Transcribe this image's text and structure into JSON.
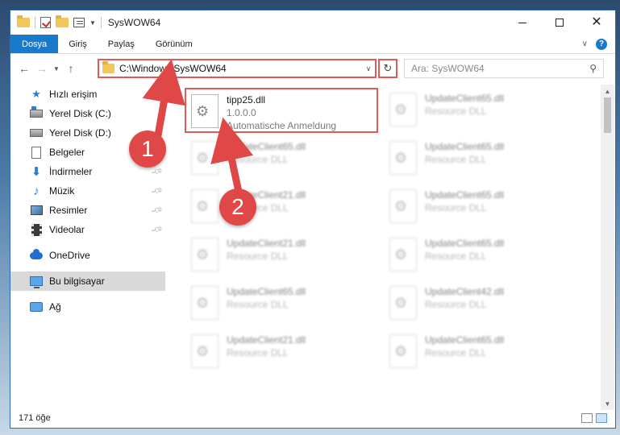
{
  "window": {
    "title": "SysWOW64"
  },
  "ribbon": {
    "tabs": [
      "Dosya",
      "Giriş",
      "Paylaş",
      "Görünüm"
    ]
  },
  "address": {
    "path": "C:\\Windows\\SysWOW64"
  },
  "search": {
    "placeholder": "Ara: SysWOW64"
  },
  "sidebar": {
    "items": [
      {
        "label": "Hızlı erişim",
        "icon": "star-icon"
      },
      {
        "label": "Yerel Disk (C:)",
        "icon": "drive-icon"
      },
      {
        "label": "Yerel Disk (D:)",
        "icon": "drive-icon"
      },
      {
        "label": "Belgeler",
        "icon": "document-icon"
      },
      {
        "label": "İndirmeler",
        "icon": "download-icon"
      },
      {
        "label": "Müzik",
        "icon": "music-icon"
      },
      {
        "label": "Resimler",
        "icon": "pictures-icon"
      },
      {
        "label": "Videolar",
        "icon": "video-icon"
      },
      {
        "label": "OneDrive",
        "icon": "cloud-icon"
      },
      {
        "label": "Bu bilgisayar",
        "icon": "computer-icon"
      },
      {
        "label": "Ağ",
        "icon": "network-icon"
      }
    ]
  },
  "files": {
    "main": {
      "name": "tipp25.dll",
      "version": "1.0.0.0",
      "desc": "Automatische Anmeldung"
    },
    "right": [
      {
        "name": "UpdateClient65.dll",
        "desc": "Resource DLL"
      },
      {
        "name": "UpdateClient65.dll",
        "desc": "Resource DLL"
      },
      {
        "name": "UpdateClient65.dll",
        "desc": "Resource DLL"
      },
      {
        "name": "UpdateClient65.dll",
        "desc": "Resource DLL"
      },
      {
        "name": "UpdateClient42.dll",
        "desc": "Resource DLL"
      },
      {
        "name": "UpdateClient65.dll",
        "desc": "Resource DLL"
      }
    ],
    "left": [
      {
        "name": "UpdateClient65.dll",
        "desc": "Resource DLL"
      },
      {
        "name": "UpdateClient21.dll",
        "desc": "Resource DLL"
      },
      {
        "name": "UpdateClient21.dll",
        "desc": "Resource DLL"
      },
      {
        "name": "UpdateClient65.dll",
        "desc": "Resource DLL"
      },
      {
        "name": "UpdateClient21.dll",
        "desc": "Resource DLL"
      }
    ]
  },
  "status": {
    "count": "171 öğe"
  },
  "annotations": {
    "badge1": "1",
    "badge2": "2",
    "color": "#e04848"
  }
}
